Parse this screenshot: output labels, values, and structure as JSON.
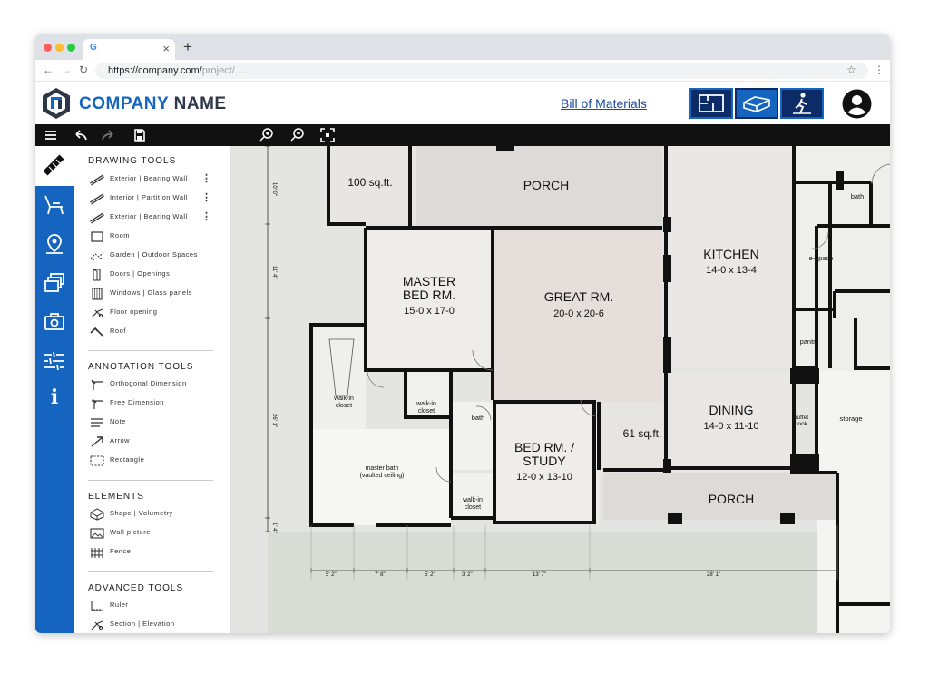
{
  "browser": {
    "tab_favicon": "G",
    "tab_close": "×",
    "new_tab": "+",
    "url_host": "https://company.com/",
    "url_path": "project/......",
    "nav": {
      "back": "←",
      "forward": "→",
      "reload": "↻",
      "bookmark": "☆",
      "menu": "⋮"
    }
  },
  "header": {
    "logo_word1": "COMPANY",
    "logo_word2": "NAME",
    "bom_link": "Bill of Materials",
    "view_buttons": [
      "floorplan-2d-icon",
      "model-3d-icon",
      "walkthrough-icon"
    ],
    "accent": "#1565c0",
    "navy": "#0d2b66"
  },
  "toolbar": {
    "icons": [
      "menu-icon",
      "undo-icon",
      "redo-icon",
      "save-icon",
      "zoom-in-icon",
      "zoom-out-icon",
      "fit-screen-icon"
    ]
  },
  "rail": {
    "icons": [
      "wall-tool-icon",
      "furniture-icon",
      "location-pin-icon",
      "layers-icon",
      "camera-icon",
      "settings-sliders-icon",
      "info-icon"
    ],
    "info_glyph": "i"
  },
  "panel": {
    "sections": [
      {
        "title": "DRAWING TOOLS",
        "items": [
          {
            "label": "Exterior | Bearing Wall",
            "icon": "wall-icon",
            "more": "⋮"
          },
          {
            "label": "Interior | Partition Wall",
            "icon": "wall-icon",
            "more": "⋮"
          },
          {
            "label": "Exterior | Bearing Wall",
            "icon": "wall-icon",
            "more": "⋮"
          },
          {
            "label": "Room",
            "icon": "room-icon"
          },
          {
            "label": "Garden | Outdoor Spaces",
            "icon": "garden-icon"
          },
          {
            "label": "Doors | Openings",
            "icon": "door-icon"
          },
          {
            "label": "Windows | Glass panels",
            "icon": "window-icon"
          },
          {
            "label": "Floor opening",
            "icon": "floor-opening-icon"
          },
          {
            "label": "Roof",
            "icon": "roof-icon"
          }
        ]
      },
      {
        "title": "ANNOTATION TOOLS",
        "items": [
          {
            "label": "Orthogonal Dimension",
            "icon": "orthogonal-dimension-icon"
          },
          {
            "label": "Free Dimension",
            "icon": "free-dimension-icon"
          },
          {
            "label": "Note",
            "icon": "note-icon"
          },
          {
            "label": "Arrow",
            "icon": "arrow-icon"
          },
          {
            "label": "Rectangle",
            "icon": "rectangle-icon"
          }
        ]
      },
      {
        "title": "ELEMENTS",
        "items": [
          {
            "label": "Shape | Volumetry",
            "icon": "shape-icon"
          },
          {
            "label": "Wall picture",
            "icon": "wall-picture-icon"
          },
          {
            "label": "Fence",
            "icon": "fence-icon"
          }
        ]
      },
      {
        "title": "ADVANCED TOOLS",
        "items": [
          {
            "label": "Ruler",
            "icon": "ruler-icon"
          },
          {
            "label": "Section | Elevation",
            "icon": "section-icon"
          }
        ]
      }
    ]
  },
  "floorplan": {
    "rooms": {
      "porch_top": {
        "name": "PORCH"
      },
      "area_top": {
        "name": "100 sq.ft."
      },
      "master": {
        "name_line1": "MASTER",
        "name_line2": "BED RM.",
        "size": "15-0 x 17-0"
      },
      "great": {
        "name": "GREAT RM.",
        "size": "20-0 x 20-6"
      },
      "kitchen": {
        "name": "KITCHEN",
        "size": "14-0 x 13-4"
      },
      "bath_top": {
        "name": "bath"
      },
      "e_space": {
        "name": "e-space"
      },
      "pantry": {
        "name": "pantry"
      },
      "walkin_left": {
        "line1": "walk-in",
        "line2": "closet"
      },
      "walkin_mid": {
        "line1": "walk-in",
        "line2": "closet"
      },
      "bath_mid": {
        "name": "bath"
      },
      "area_mid": {
        "name": "61 sq.ft."
      },
      "dining": {
        "name": "DINING",
        "size": "14-0 x 11-10"
      },
      "buffet": {
        "line1": "buffet",
        "line2": "nook"
      },
      "storage": {
        "name": "storage"
      },
      "master_bath": {
        "line1": "master bath",
        "line2": "(vaulted ceiling)"
      },
      "bed_study": {
        "line1": "BED RM. /",
        "line2": "STUDY",
        "size": "12-0 x 13-10"
      },
      "walkin_low": {
        "line1": "walk-in",
        "line2": "closet"
      },
      "porch_bottom": {
        "name": "PORCH"
      }
    },
    "dims_vertical": [
      "10' 0\"",
      "11' 4\"",
      "26' 1\"",
      "1' 4\""
    ],
    "dims_horizontal": [
      "5' 2\"",
      "7' 8\"",
      "5' 2\"",
      "3' 2\"",
      "13' 7\"",
      "28' 1\""
    ]
  }
}
